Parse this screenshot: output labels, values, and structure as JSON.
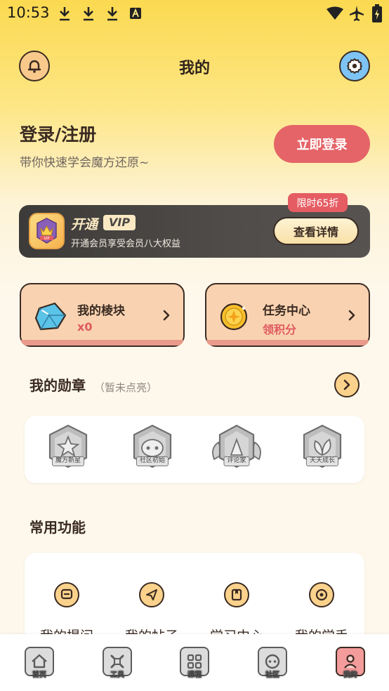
{
  "status_bar": {
    "time": "10:53"
  },
  "header": {
    "title": "我的"
  },
  "login": {
    "title": "登录/注册",
    "subtitle": "带你快速学会魔方还原~",
    "button": "立即登录"
  },
  "vip": {
    "title": "开通",
    "tag": "VIP",
    "desc": "开通会员享受会员八大权益",
    "button": "查看详情",
    "promo": "限时65折"
  },
  "cards": [
    {
      "title": "我的棱块",
      "value": "x0"
    },
    {
      "title": "任务中心",
      "value": "领积分"
    }
  ],
  "medals": {
    "title": "我的勋章",
    "hint": "（暂未点亮）",
    "items": [
      {
        "label": "魔方新星"
      },
      {
        "label": "社区初始"
      },
      {
        "label": "评论家"
      },
      {
        "label": "天天成长"
      }
    ]
  },
  "functions": {
    "title": "常用功能",
    "items": [
      {
        "label": "我的提问"
      },
      {
        "label": "我的帖子"
      },
      {
        "label": "学习中心"
      },
      {
        "label": "我的学手"
      }
    ]
  },
  "nav": [
    {
      "label": "首页"
    },
    {
      "label": "工具"
    },
    {
      "label": "课程"
    },
    {
      "label": "社区"
    },
    {
      "label": "我的"
    }
  ],
  "colors": {
    "primary_red": "#e56468",
    "accent_yellow": "#fbd28c",
    "outline": "#3a2a22"
  }
}
